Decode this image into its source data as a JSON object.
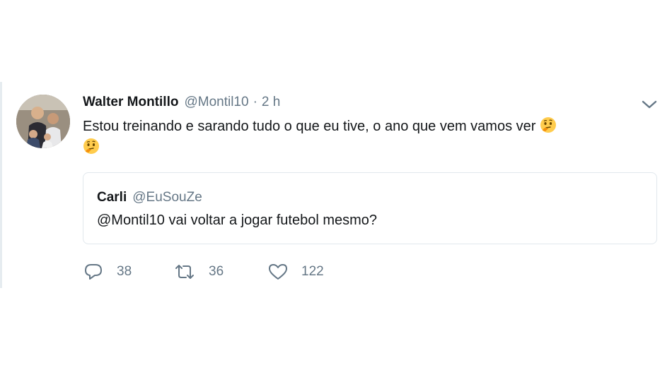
{
  "tweet": {
    "author_name": "Walter Montillo",
    "author_handle": "@Montil10",
    "separator": "·",
    "time": "2 h",
    "text": "Estou treinando e sarando tudo o que eu tive, o ano que vem vamos ver",
    "emoji": [
      "thinking-face",
      "thinking-face"
    ],
    "menu_icon": "chevron-down-icon",
    "avatar_icon": "avatar-photo"
  },
  "quoted_tweet": {
    "author_name": "Carli",
    "author_handle": "@EuSouZe",
    "text": "@Montil10 vai voltar a jogar futebol mesmo?"
  },
  "actions": {
    "reply": {
      "icon": "reply-icon",
      "count": "38"
    },
    "retweet": {
      "icon": "retweet-icon",
      "count": "36"
    },
    "like": {
      "icon": "heart-icon",
      "count": "122"
    }
  },
  "colors": {
    "text": "#14171a",
    "secondary": "#657786",
    "border": "#e1e8ed",
    "emoji": "#ffcc4d"
  }
}
